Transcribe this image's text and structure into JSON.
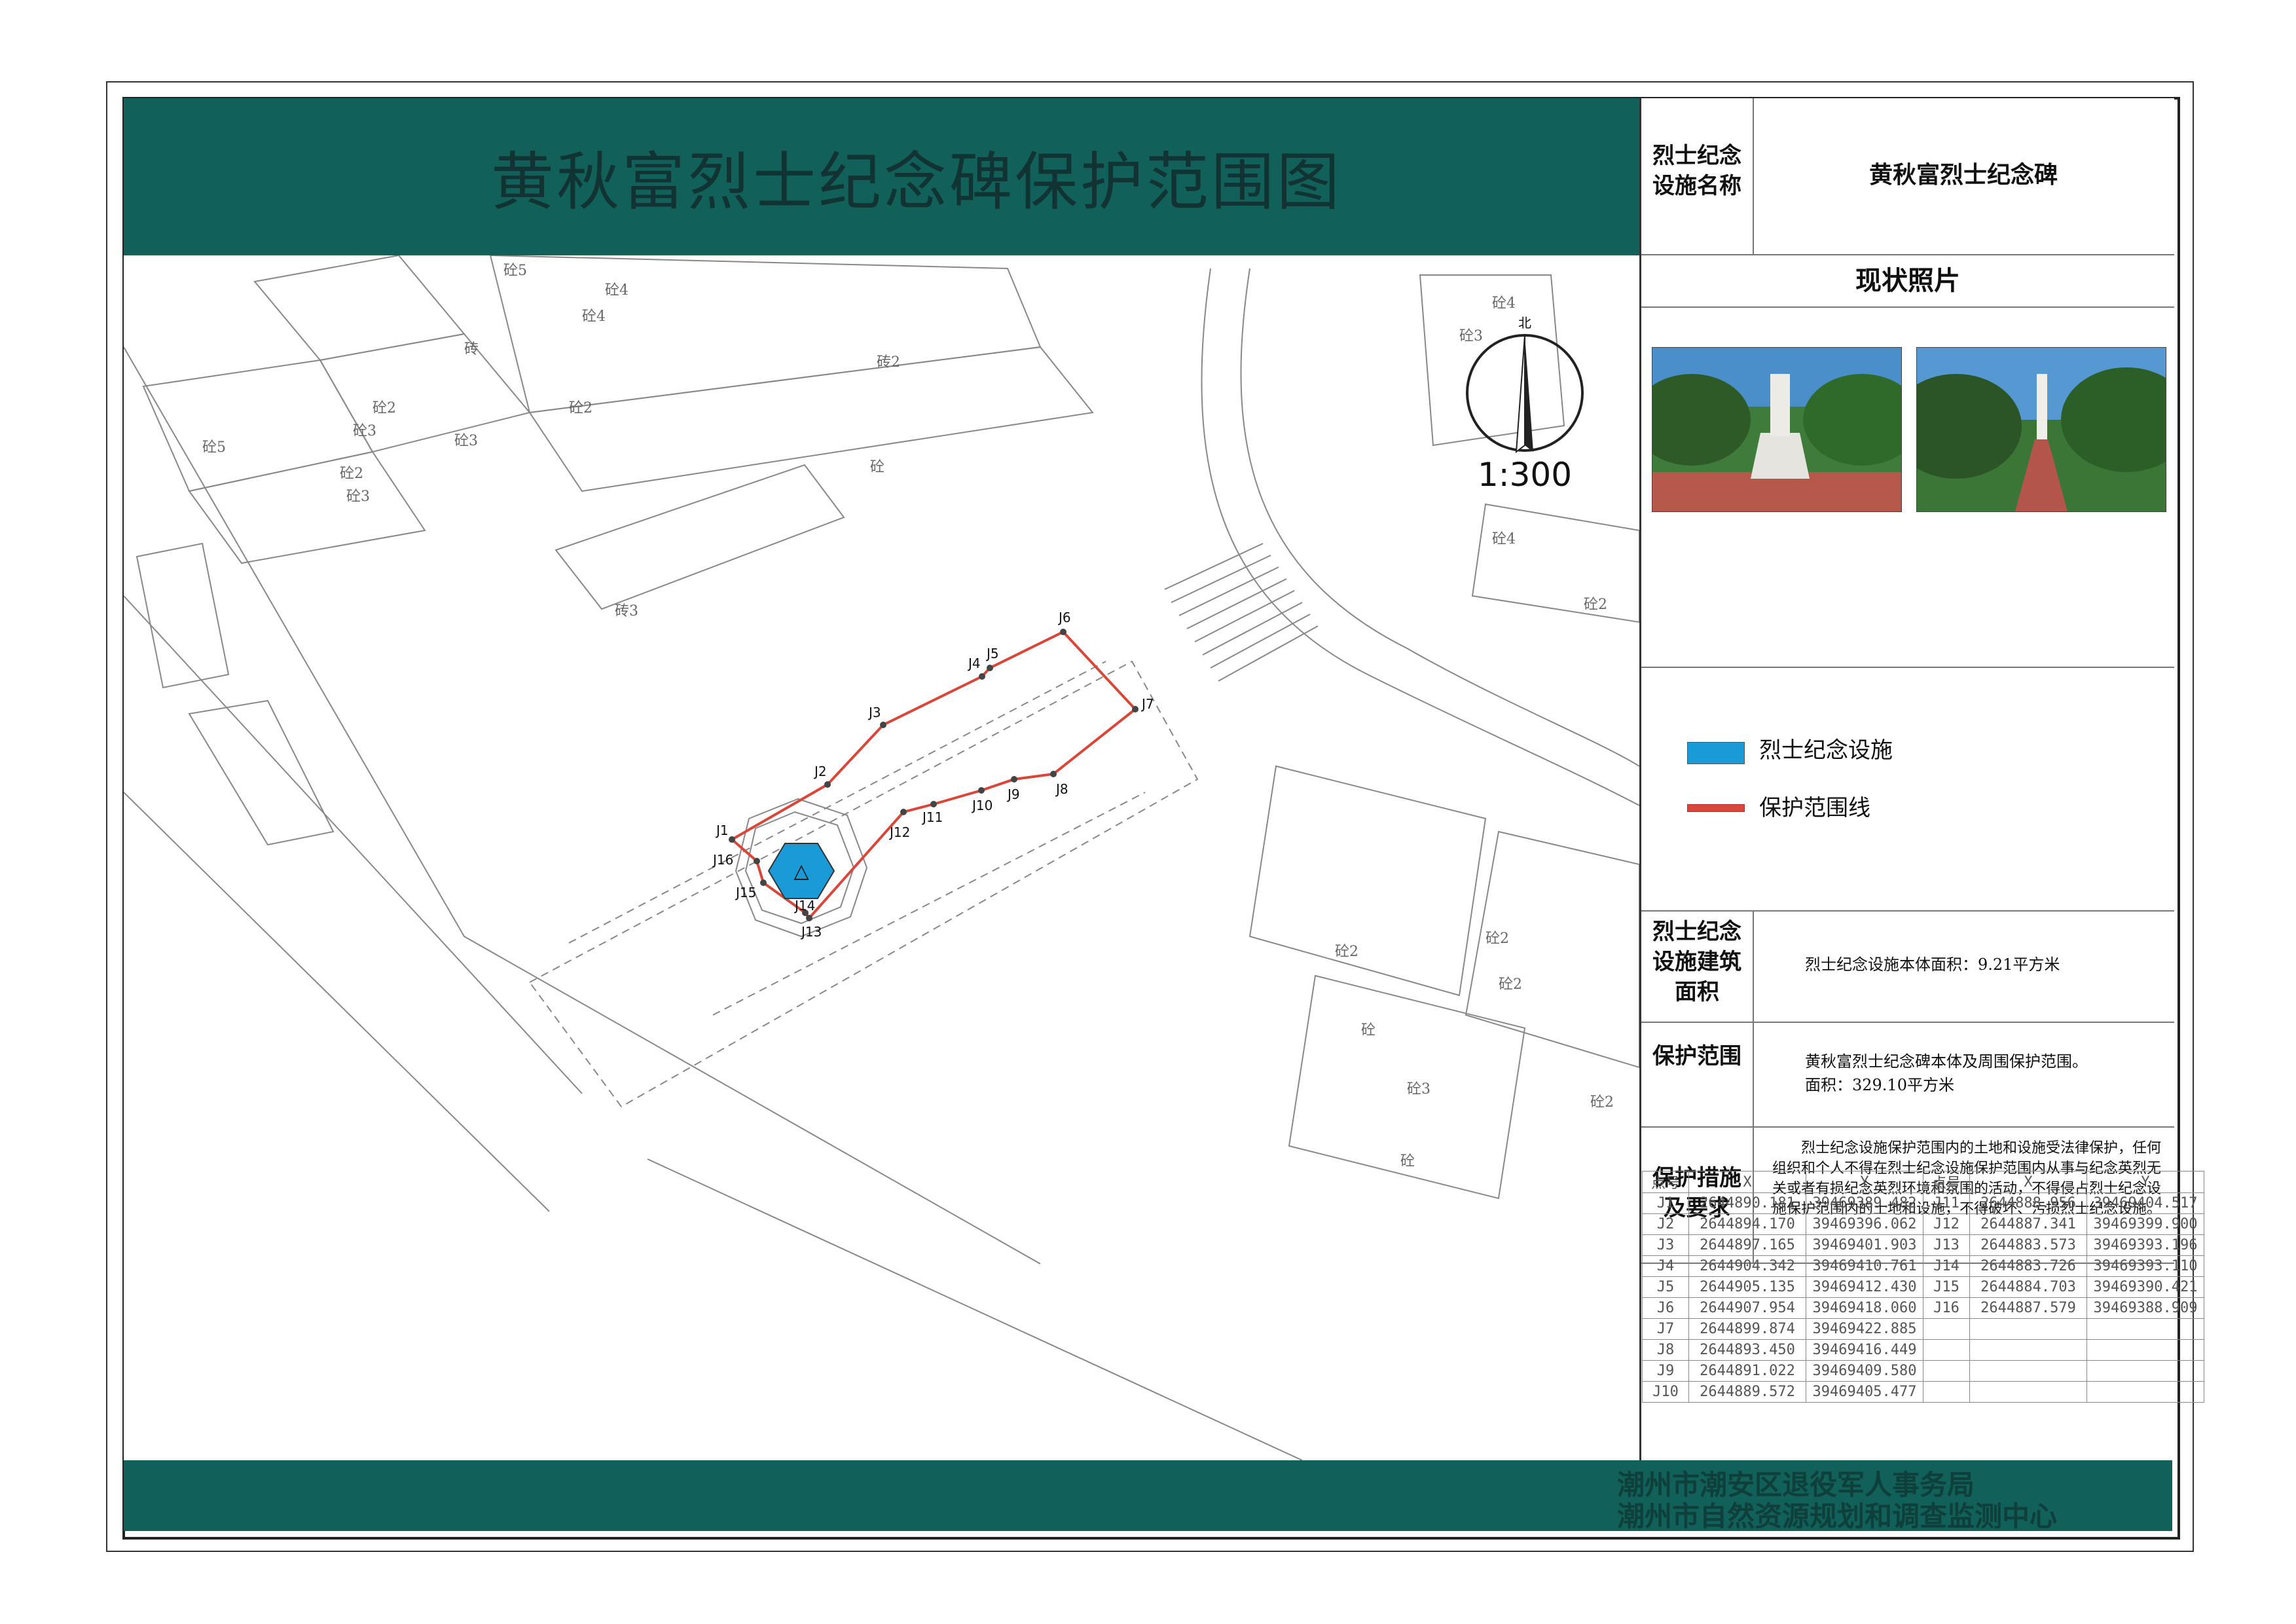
{
  "title": "黄秋富烈士纪念碑保护范围图",
  "facility": {
    "name_label": "烈士纪念设施名称",
    "name_value": "黄秋富烈士纪念碑",
    "photo_header": "现状照片"
  },
  "legend": {
    "items": [
      {
        "label": "烈士纪念设施",
        "color": "#1a9ad6"
      },
      {
        "label": "保护范围线",
        "color": "#d9473a"
      }
    ]
  },
  "building_area": {
    "label": "烈士纪念设施建筑面积",
    "value": "烈士纪念设施本体面积：9.21平方米"
  },
  "protection_scope": {
    "label": "保护范围",
    "value_line1": "黄秋富烈士纪念碑本体及周围保护范围。",
    "value_line2": "面积：329.10平方米"
  },
  "measures": {
    "label": "保护措施及要求",
    "text": "烈士纪念设施保护范围内的土地和设施受法律保护，任何组织和个人不得在烈士纪念设施保护范围内从事与纪念英烈无关或者有损纪念英烈环境和氛围的活动，不得侵占烈士纪念设施保护范围内的土地和设施，不得破坏、污损烈士纪念设施。"
  },
  "compass": {
    "north": "北",
    "scale": "1:300"
  },
  "coordinates": {
    "headers": [
      "点号",
      "X",
      "Y",
      "点号",
      "X",
      "Y"
    ],
    "rows": [
      [
        "J1",
        "2644890.181",
        "39469389.482",
        "J11",
        "2644888.956",
        "39469404.517"
      ],
      [
        "J2",
        "2644894.170",
        "39469396.062",
        "J12",
        "2644887.341",
        "39469399.900"
      ],
      [
        "J3",
        "2644897.165",
        "39469401.903",
        "J13",
        "2644883.573",
        "39469393.196"
      ],
      [
        "J4",
        "2644904.342",
        "39469410.761",
        "J14",
        "2644883.726",
        "39469393.110"
      ],
      [
        "J5",
        "2644905.135",
        "39469412.430",
        "J15",
        "2644884.703",
        "39469390.421"
      ],
      [
        "J6",
        "2644907.954",
        "39469418.060",
        "J16",
        "2644887.579",
        "39469388.909"
      ],
      [
        "J7",
        "2644899.874",
        "39469422.885",
        "",
        "",
        ""
      ],
      [
        "J8",
        "2644893.450",
        "39469416.449",
        "",
        "",
        ""
      ],
      [
        "J9",
        "2644891.022",
        "39469409.580",
        "",
        "",
        ""
      ],
      [
        "J10",
        "2644889.572",
        "39469405.477",
        "",
        "",
        ""
      ]
    ]
  },
  "map_labels": {
    "points": [
      "J1",
      "J2",
      "J3",
      "J4",
      "J5",
      "J6",
      "J7",
      "J8",
      "J9",
      "J10",
      "J11",
      "J12",
      "J13",
      "J14",
      "J15",
      "J16"
    ],
    "building_marks": [
      "砼5",
      "砼4",
      "砼4",
      "砖",
      "砼2",
      "砼3",
      "砼3",
      "砼5",
      "砼2",
      "砼3",
      "砼2",
      "砖2",
      "砼",
      "砖3",
      "砼",
      "砼3",
      "砼4",
      "砼4",
      "砼2",
      "砼2",
      "砼2",
      "砼2",
      "砼3",
      "砼",
      "砼2",
      "砼"
    ]
  },
  "agency": {
    "line1": "潮州市潮安区退役军人事务局",
    "line2": "潮州市自然资源规划和调查监测中心"
  }
}
